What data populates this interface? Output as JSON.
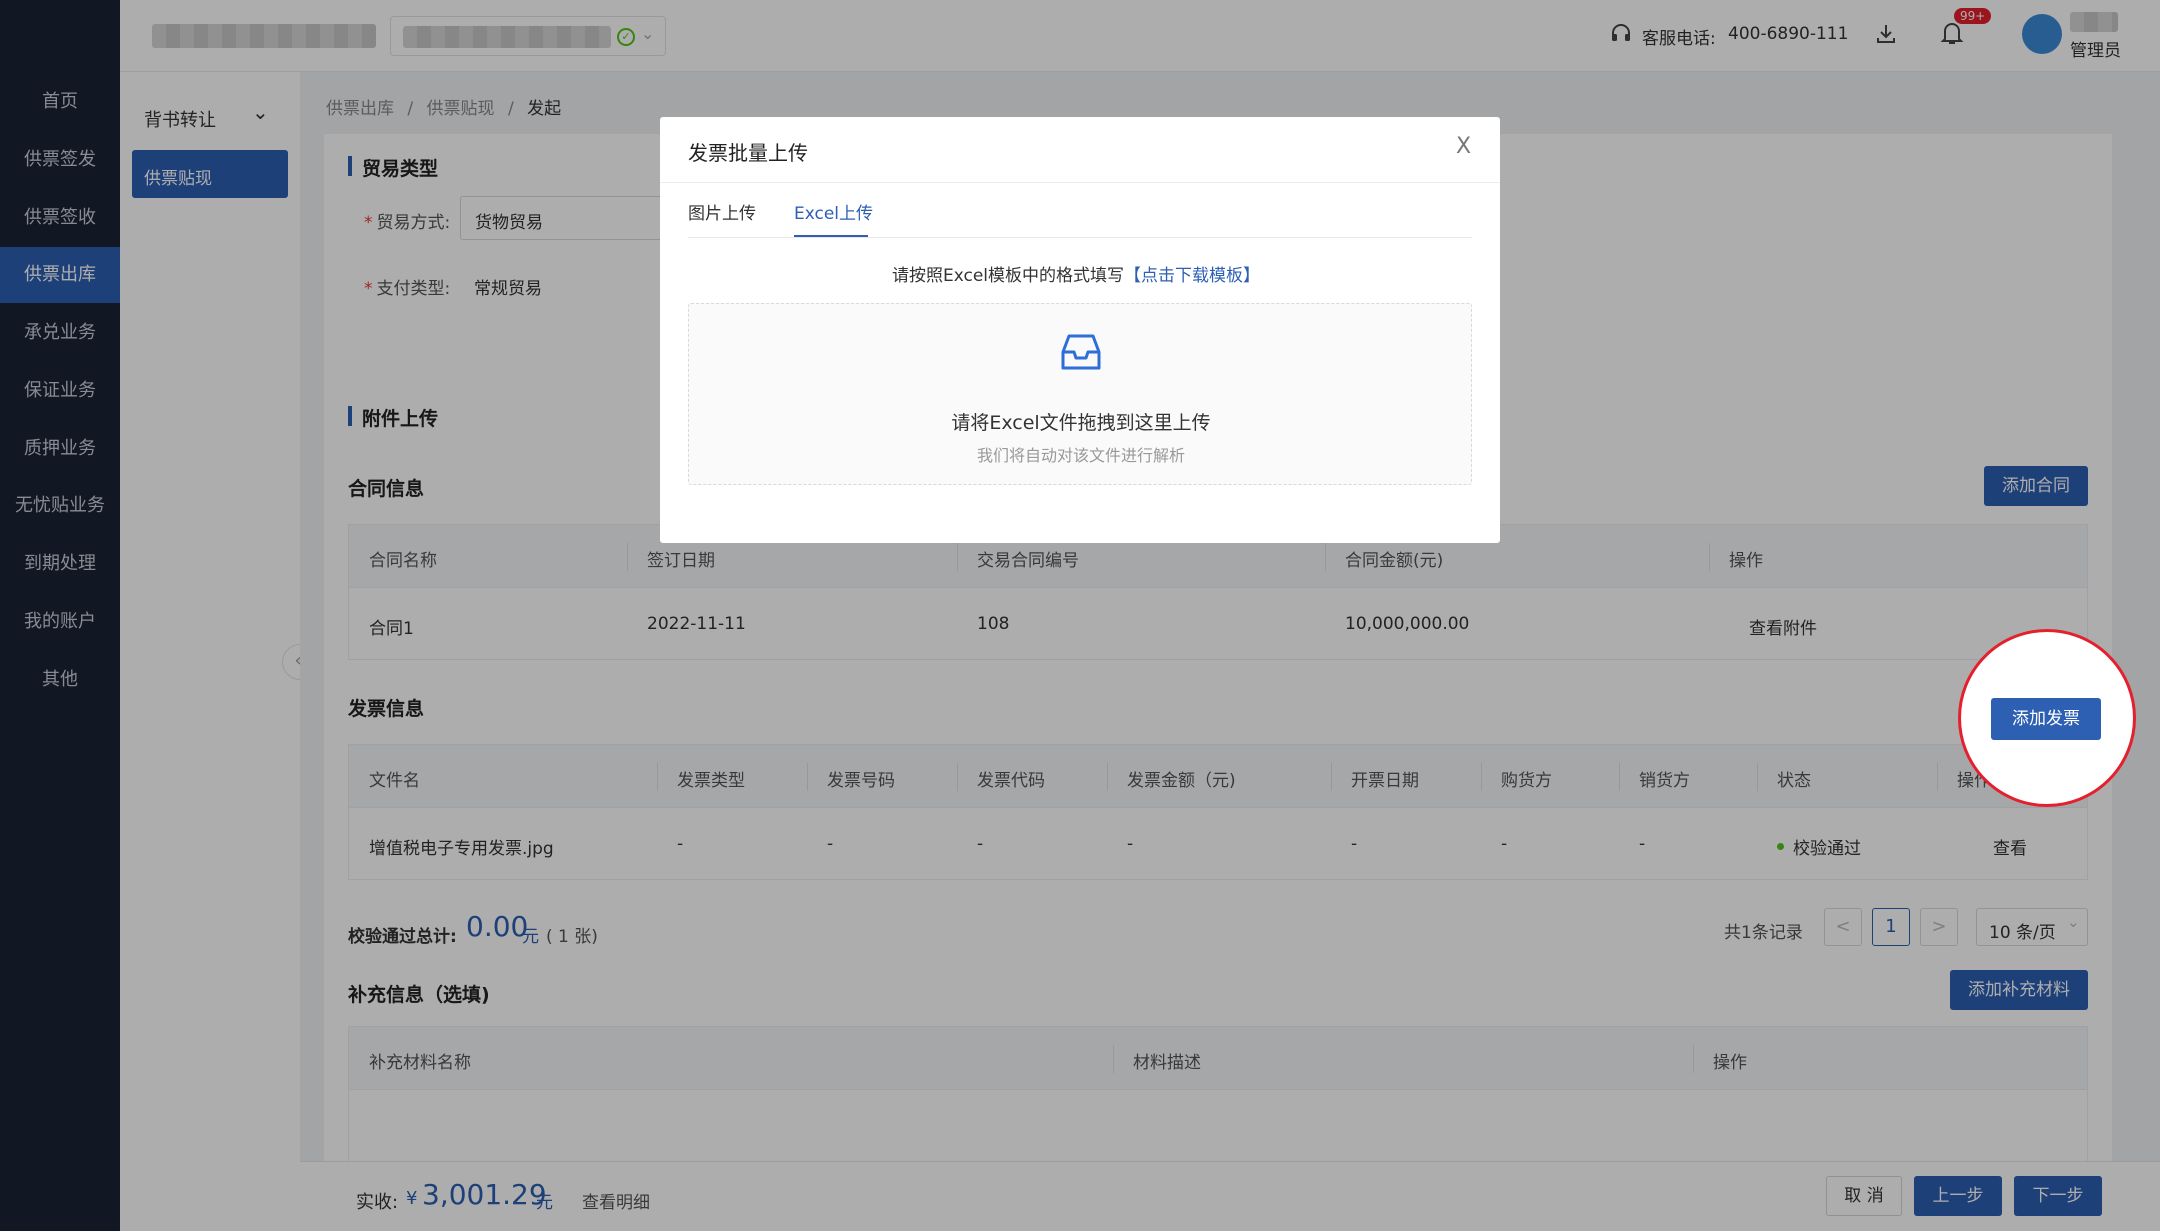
{
  "nav": {
    "items": [
      "首页",
      "供票签发",
      "供票签收",
      "供票出库",
      "承兑业务",
      "保证业务",
      "质押业务",
      "无忧贴业务",
      "到期处理",
      "我的账户",
      "其他"
    ],
    "active_index": 3
  },
  "header": {
    "hotline_label": "客服电话:",
    "hotline_number": "400-6890-111",
    "notification_badge": "99+",
    "user_role": "管理员"
  },
  "submenu": {
    "group_label": "背书转让",
    "active_item": "供票贴现",
    "collapse_glyph": "«"
  },
  "breadcrumb": [
    "供票出库",
    "供票贴现",
    "发起"
  ],
  "trade": {
    "title": "贸易类型",
    "method_label": "贸易方式:",
    "method_value": "货物贸易",
    "payment_label": "支付类型:",
    "payment_value": "常规贸易"
  },
  "attachments": {
    "title": "附件上传",
    "contract": {
      "title": "合同信息",
      "add_button": "添加合同",
      "columns": [
        "合同名称",
        "签订日期",
        "交易合同编号",
        "合同金额(元)",
        "操作"
      ],
      "rows": [
        {
          "name": "合同1",
          "date": "2022-11-11",
          "number": "108",
          "amount": "10,000,000.00",
          "action": "查看附件"
        }
      ]
    },
    "invoice": {
      "title": "发票信息",
      "add_button": "添加发票",
      "columns": [
        "文件名",
        "发票类型",
        "发票号码",
        "发票代码",
        "发票金额（元)",
        "开票日期",
        "购货方",
        "销货方",
        "状态",
        "操作"
      ],
      "rows": [
        {
          "file": "增值税电子专用发票.jpg",
          "type": "-",
          "number": "-",
          "code": "-",
          "amount": "-",
          "date": "-",
          "buyer": "-",
          "seller": "-",
          "status": "校验通过",
          "action": "查看"
        }
      ],
      "total_label": "校验通过总计:",
      "total_value": "0.00",
      "total_unit": "元",
      "total_count": "( 1 张)",
      "pagination": {
        "total_text": "共1条记录",
        "prev": "<",
        "page": "1",
        "next": ">",
        "page_size": "10 条/页"
      }
    },
    "supplement": {
      "title": "补充信息（选填)",
      "add_button": "添加补充材料",
      "columns": [
        "补充材料名称",
        "材料描述",
        "操作"
      ]
    }
  },
  "modal": {
    "title": "发票批量上传",
    "close_glyph": "X",
    "tabs": [
      "图片上传",
      "Excel上传"
    ],
    "active_tab": 1,
    "hint_text": "请按照Excel模板中的格式填写",
    "download_link": "【点击下载模板】",
    "drop_main": "请将Excel文件拖拽到这里上传",
    "drop_sub": "我们将自动对该文件进行解析"
  },
  "bottom": {
    "received_label": "实收:",
    "currency": "¥",
    "amount": "3,001.29",
    "unit": "元",
    "detail_link": "查看明细",
    "cancel": "取 消",
    "prev": "上一步",
    "next": "下一步"
  },
  "colors": {
    "primary": "#2d5fb3",
    "nav_bg": "#1b2236",
    "success": "#52c41a",
    "badge": "#e5202e"
  }
}
